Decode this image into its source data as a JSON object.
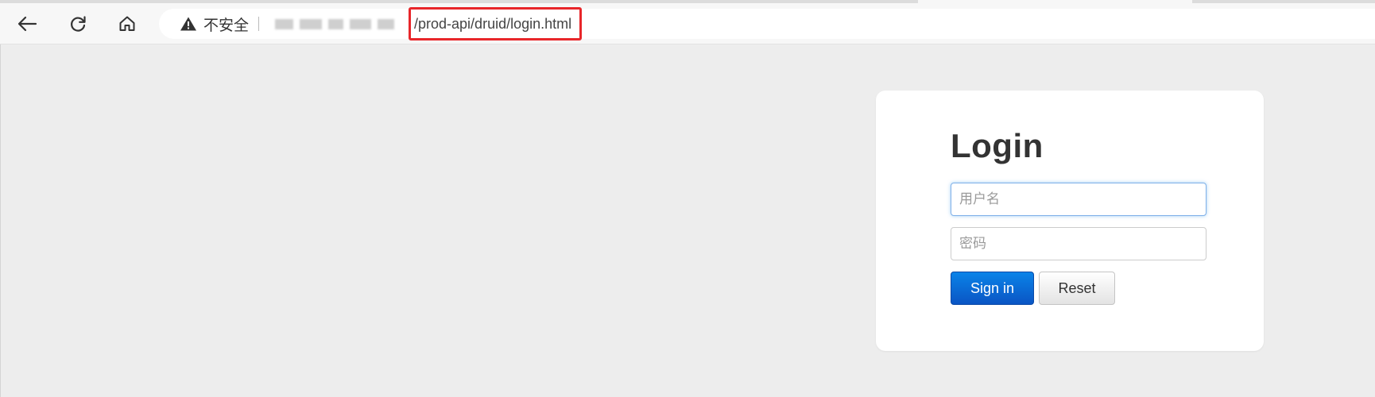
{
  "browser": {
    "security_label": "不安全",
    "url_path": "/prod-api/druid/login.html",
    "icons": {
      "back": "back-arrow-icon",
      "reload": "reload-icon",
      "home": "home-icon",
      "warning": "warning-triangle-icon"
    }
  },
  "login": {
    "title": "Login",
    "username_placeholder": "用户名",
    "password_placeholder": "密码",
    "signin_label": "Sign in",
    "reset_label": "Reset"
  },
  "colors": {
    "page_background": "#ededed",
    "primary_button": "#0a6ad8",
    "url_highlight_border": "#e8262a",
    "focus_ring": "#52a8ec"
  }
}
